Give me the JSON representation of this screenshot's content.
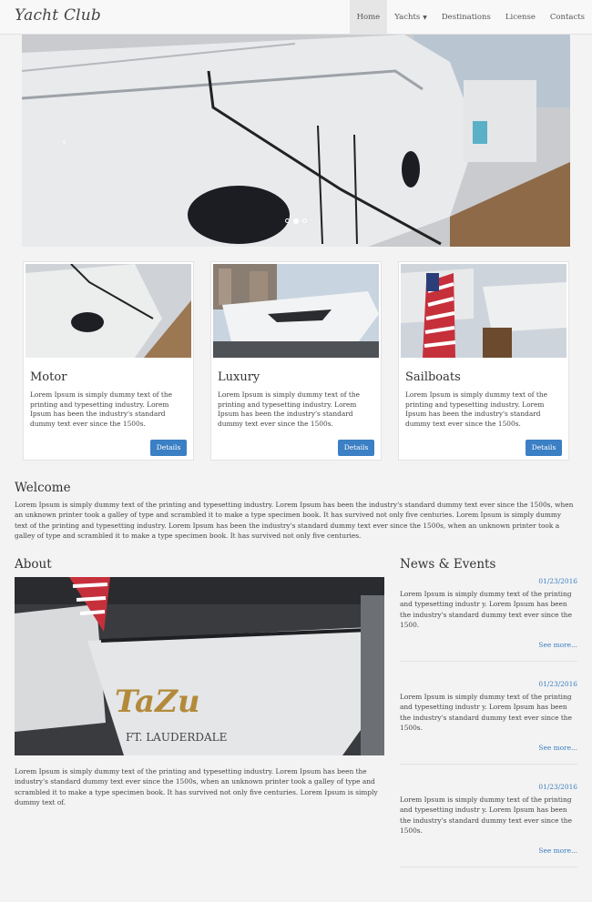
{
  "navbar": {
    "brand": "Yacht Club",
    "items": [
      {
        "label": "Home"
      },
      {
        "label": "Yachts"
      },
      {
        "label": "Destinations"
      },
      {
        "label": "License"
      },
      {
        "label": "Contacts"
      }
    ]
  },
  "slider": {
    "prev_glyph": "‹"
  },
  "cards": [
    {
      "title": "Motor",
      "text": "Lorem Ipsum is simply dummy text of the printing and typesetting industry. Lorem Ipsum has been the industry's standard dummy text ever since the 1500s.",
      "button": "Details"
    },
    {
      "title": "Luxury",
      "text": "Lorem Ipsum is simply dummy text of the printing and typesetting industry. Lorem Ipsum has been the industry's standard dummy text ever since the 1500s.",
      "button": "Details"
    },
    {
      "title": "Sailboats",
      "text": "Lorem Ipsum is simply dummy text of the printing and typesetting industry. Lorem Ipsum has been the industry's standard dummy text ever since the 1500s.",
      "button": "Details"
    }
  ],
  "welcome": {
    "title": "Welcome",
    "text": "Lorem Ipsum is simply dummy text of the printing and typesetting industry. Lorem Ipsum has been the industry's standard dummy text ever since the 1500s, when an unknown printer took a galley of type and scrambled it to make a type specimen book. It has survived not only five centuries. Lorem Ipsum is simply dummy text of the printing and typesetting industry. Lorem Ipsum has been the industry's standard dummy text ever since the 1500s, when an unknown printer took a galley of type and scrambled it to make a type specimen book. It has survived not only five centuries."
  },
  "about": {
    "title": "About",
    "image_text": "TaZu",
    "image_subtext": "FT. LAUDERDALE",
    "text": "Lorem Ipsum is simply dummy text of the printing and typesetting industry. Lorem Ipsum has been the industry's standard dummy text ever since the 1500s, when an unknown printer took a galley of type and scrambled it to make a type specimen book. It has survived not only five centuries. Lorem Ipsum is simply dummy text of."
  },
  "news": {
    "title": "News & Events",
    "items": [
      {
        "date": "01/23/2016",
        "text": "Lorem Ipsum is simply dummy text of the printing and typesetting industr y. Lorem Ipsum has been the industry's standard dummy text ever since the 1500.",
        "more": "See more..."
      },
      {
        "date": "01/23/2016",
        "text": "Lorem Ipsum is simply dummy text of the printing and typesetting industr y. Lorem Ipsum has been the industry's standard dummy text ever since the 1500s.",
        "more": "See more..."
      },
      {
        "date": "01/23/2016",
        "text": "Lorem Ipsum is simply dummy text of the printing and typesetting industr y. Lorem Ipsum has been the industry's standard dummy text ever since the 1500s.",
        "more": "See more..."
      }
    ]
  },
  "colors": {
    "accent": "#3b7fc4",
    "link": "#3a7dbf",
    "nav_bg": "#f8f8f8",
    "page_bg": "#f3f3f3"
  }
}
